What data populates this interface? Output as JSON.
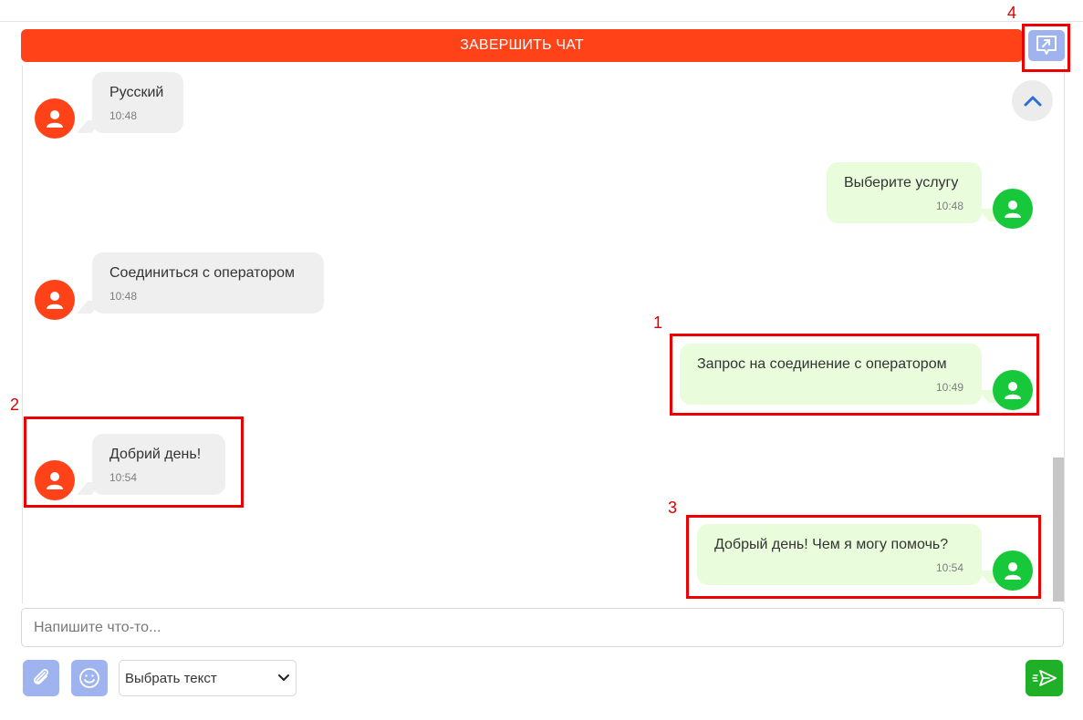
{
  "header": {
    "end_chat_label": "ЗАВЕРШИТЬ ЧАТ",
    "popout_icon": "popout-chat-icon"
  },
  "messages": [
    {
      "sender": "operator",
      "text": "Русский",
      "time": "10:48"
    },
    {
      "sender": "bot",
      "text": "Выберите услугу",
      "time": "10:48"
    },
    {
      "sender": "operator",
      "text": "Соединиться с оператором",
      "time": "10:48"
    },
    {
      "sender": "bot",
      "text": "Запрос на соединение с оператором",
      "time": "10:49"
    },
    {
      "sender": "operator",
      "text": "Добрий день!",
      "time": "10:54"
    },
    {
      "sender": "bot",
      "text": "Добрый день! Чем я могу помочь?",
      "time": "10:54"
    }
  ],
  "annotations": [
    "1",
    "2",
    "3",
    "4"
  ],
  "composer": {
    "placeholder": "Напишите что-то...",
    "select_value": "Выбрать текст"
  },
  "colors": {
    "accent_red": "#ff4218",
    "bot_green": "#17c93a",
    "send_green": "#1fb027",
    "tool_blue": "#9fb3ee",
    "incoming_bubble": "#efefef",
    "outgoing_bubble": "#e9fddc",
    "annotation_red": "#ee0000"
  }
}
